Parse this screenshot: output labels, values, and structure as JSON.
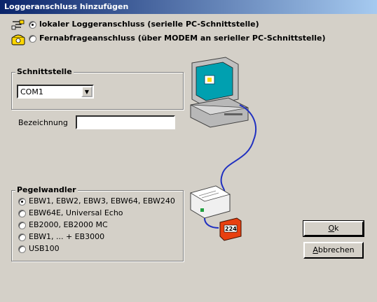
{
  "window": {
    "title": "Loggeranschluss hinzufügen"
  },
  "connection_options": [
    {
      "label": "lokaler Loggeranschluss (serielle PC-Schnittstelle)",
      "selected": true,
      "icon": "serial-cable-icon"
    },
    {
      "label": "Fernabfrageanschluss (über MODEM an serieller PC-Schnittstelle)",
      "selected": false,
      "icon": "modem-phone-icon"
    }
  ],
  "schnittstelle": {
    "title": "Schnittstelle",
    "selected": "COM1"
  },
  "bezeichnung": {
    "label": "Bezeichnung",
    "value": ""
  },
  "pegelwandler": {
    "title": "Pegelwandler",
    "options": [
      {
        "label": "EBW1, EBW2, EBW3, EBW64, EBW240",
        "selected": true
      },
      {
        "label": "EBW64E, Universal Echo",
        "selected": false
      },
      {
        "label": "EB2000, EB2000 MC",
        "selected": false
      },
      {
        "label": "EBW1, ... + EB3000",
        "selected": false
      },
      {
        "label": "USB100",
        "selected": false
      }
    ]
  },
  "buttons": {
    "ok_prefix": "O",
    "ok_rest": "k",
    "cancel_prefix": "A",
    "cancel_rest": "bbrechen"
  },
  "illustration": {
    "logger_display": "224",
    "icons": [
      "computer-icon",
      "converter-box-icon",
      "logger-device-icon"
    ]
  }
}
